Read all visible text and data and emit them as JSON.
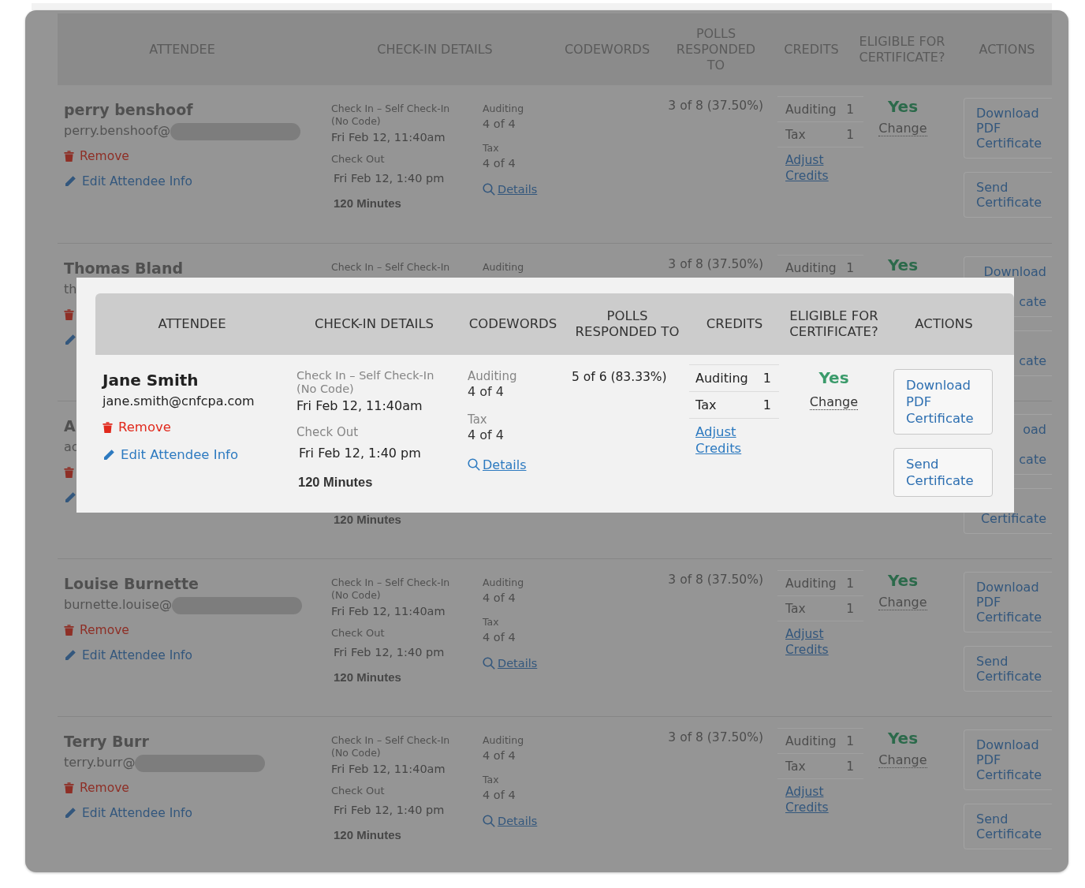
{
  "table": {
    "columns": [
      "ATTENDEE",
      "CHECK-IN DETAILS",
      "CODEWORDS",
      "POLLS RESPONDED TO",
      "CREDITS",
      "ELIGIBLE FOR CERTIFICATE?",
      "ACTIONS"
    ],
    "rows": [
      {
        "kind": "full",
        "name": "perry benshoof",
        "email": "perry.benshoof@",
        "email_redacted": true,
        "remove": "Remove",
        "edit": "Edit Attendee Info",
        "check_in": {
          "label": "Check In – Self Check-In",
          "note": "(No Code)",
          "time": "Fri Feb 12, 11:40am",
          "out_label": "Check Out",
          "out_time": "Fri Feb 12, 1:40 pm",
          "duration": "120 Minutes"
        },
        "codewords": [
          {
            "label": "Auditing",
            "value": "4 of 4"
          },
          {
            "label": "Tax",
            "value": "4 of 4"
          }
        ],
        "details": "Details",
        "polls": "3 of 8 (37.50%)",
        "credits": [
          {
            "name": "Auditing",
            "value": "1"
          },
          {
            "name": "Tax",
            "value": "1"
          }
        ],
        "adjust": "Adjust Credits",
        "eligible": "Yes",
        "change": "Change",
        "actions": [
          {
            "first": "Download",
            "middle": "PDF",
            "last": "Certificate"
          },
          {
            "first": "Send",
            "last": "Certificate"
          }
        ]
      },
      {
        "kind": "covered",
        "name": "Thomas Bland",
        "email": "th",
        "check_in": {
          "label": "Check In – Self Check-In"
        },
        "codewords": [
          {
            "label": "Auditing"
          }
        ],
        "polls": "3 of 8 (37.50%)",
        "credits": [
          {
            "name": "Auditing",
            "value": "1"
          }
        ],
        "eligible": "Yes",
        "actions": [
          {
            "first": "Download",
            "last": "cate"
          },
          {
            "last": "cate"
          }
        ]
      },
      {
        "kind": "covered",
        "name": "A",
        "email": "ac",
        "check_in": {
          "duration": "120 Minutes"
        },
        "actions": [
          {
            "first": "oad",
            "last": "cate"
          },
          {
            "last": "Certificate"
          }
        ]
      },
      {
        "kind": "full",
        "name": "Louise Burnette",
        "email": "burnette.louise@",
        "email_redacted": true,
        "remove": "Remove",
        "edit": "Edit Attendee Info",
        "check_in": {
          "label": "Check In – Self Check-In",
          "note": "(No Code)",
          "time": "Fri Feb 12, 11:40am",
          "out_label": "Check Out",
          "out_time": "Fri Feb 12, 1:40 pm",
          "duration": "120 Minutes"
        },
        "codewords": [
          {
            "label": "Auditing",
            "value": "4 of 4"
          },
          {
            "label": "Tax",
            "value": "4 of 4"
          }
        ],
        "details": "Details",
        "polls": "3 of 8 (37.50%)",
        "credits": [
          {
            "name": "Auditing",
            "value": "1"
          },
          {
            "name": "Tax",
            "value": "1"
          }
        ],
        "adjust": "Adjust Credits",
        "eligible": "Yes",
        "change": "Change",
        "actions": [
          {
            "first": "Download",
            "middle": "PDF",
            "last": "Certificate"
          },
          {
            "first": "Send",
            "last": "Certificate"
          }
        ]
      },
      {
        "kind": "full",
        "name": "Terry Burr",
        "email": "terry.burr@",
        "email_redacted": true,
        "remove": "Remove",
        "edit": "Edit Attendee Info",
        "check_in": {
          "label": "Check In – Self Check-In",
          "note": "(No Code)",
          "time": "Fri Feb 12, 11:40am",
          "out_label": "Check Out",
          "out_time": "Fri Feb 12, 1:40 pm",
          "duration": "120 Minutes"
        },
        "codewords": [
          {
            "label": "Auditing",
            "value": "4 of 4"
          },
          {
            "label": "Tax",
            "value": "4 of 4"
          }
        ],
        "details": "Details",
        "polls": "3 of 8 (37.50%)",
        "credits": [
          {
            "name": "Auditing",
            "value": "1"
          },
          {
            "name": "Tax",
            "value": "1"
          }
        ],
        "adjust": "Adjust Credits",
        "eligible": "Yes",
        "change": "Change",
        "actions": [
          {
            "first": "Download",
            "middle": "PDF",
            "last": "Certificate"
          },
          {
            "first": "Send",
            "last": "Certificate"
          }
        ]
      }
    ]
  },
  "spotlight": {
    "columns": [
      "ATTENDEE",
      "CHECK-IN DETAILS",
      "CODEWORDS",
      "POLLS RESPONDED TO",
      "CREDITS",
      "ELIGIBLE FOR CERTIFICATE?",
      "ACTIONS"
    ],
    "rows": [
      {
        "kind": "full",
        "name": "Jane Smith",
        "email": "jane.smith@cnfcpa.com",
        "remove": "Remove",
        "edit": "Edit Attendee Info",
        "check_in": {
          "label": "Check In – Self Check-In",
          "note": "(No Code)",
          "time": "Fri Feb 12, 11:40am",
          "out_label": "Check Out",
          "out_time": "Fri Feb 12, 1:40 pm",
          "duration": "120 Minutes"
        },
        "codewords": [
          {
            "label": "Auditing",
            "value": "4 of 4"
          },
          {
            "label": "Tax",
            "value": "4 of 4"
          }
        ],
        "details": "Details",
        "polls": "5 of 6 (83.33%)",
        "credits": [
          {
            "name": "Auditing",
            "value": "1"
          },
          {
            "name": "Tax",
            "value": "1"
          }
        ],
        "adjust": "Adjust Credits",
        "eligible": "Yes",
        "change": "Change",
        "actions": [
          {
            "first": "Download",
            "middle": "PDF",
            "last": "Certificate"
          },
          {
            "first": "Send",
            "last": "Certificate"
          }
        ]
      }
    ]
  }
}
